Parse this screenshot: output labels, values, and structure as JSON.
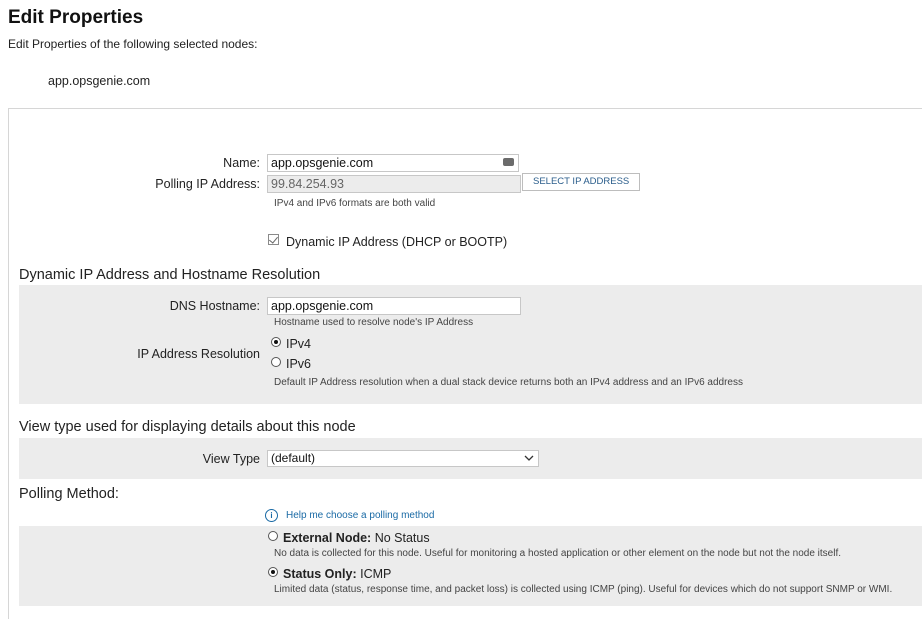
{
  "header": {
    "title": "Edit Properties",
    "subtitle": "Edit Properties of the following selected nodes:",
    "node": "app.opsgenie.com"
  },
  "general": {
    "name_label": "Name:",
    "name_value": "app.opsgenie.com",
    "polling_ip_label": "Polling IP Address:",
    "polling_ip_value": "99.84.254.93",
    "select_ip_button": "SELECT IP ADDRESS",
    "ip_hint": "IPv4 and IPv6 formats are both valid",
    "dynamic_ip_label": "Dynamic IP Address (DHCP or BOOTP)",
    "dynamic_ip_checked": true
  },
  "dynamic_section": {
    "heading": "Dynamic IP Address and Hostname Resolution",
    "dns_label": "DNS Hostname:",
    "dns_value": "app.opsgenie.com",
    "dns_hint": "Hostname used to resolve node's IP Address",
    "resolution_label": "IP Address Resolution",
    "options": [
      {
        "label": "IPv4",
        "selected": true
      },
      {
        "label": "IPv6",
        "selected": false
      }
    ],
    "resolution_hint": "Default IP Address resolution when a dual stack device returns both an IPv4 address and an IPv6 address"
  },
  "view_section": {
    "heading": "View type used for displaying details about this node",
    "view_type_label": "View Type",
    "view_type_value": "(default)"
  },
  "polling_section": {
    "heading": "Polling Method:",
    "help_link": "Help me choose a polling method",
    "methods": [
      {
        "name": "External Node:",
        "value": "No Status",
        "selected": false,
        "description": "No data is collected for this node. Useful for monitoring a hosted application or other element on the node but not the node itself."
      },
      {
        "name": "Status Only:",
        "value": "ICMP",
        "selected": true,
        "description": "Limited data (status, response time, and packet loss) is collected using ICMP (ping). Useful for devices which do not support SNMP or WMI."
      }
    ]
  }
}
